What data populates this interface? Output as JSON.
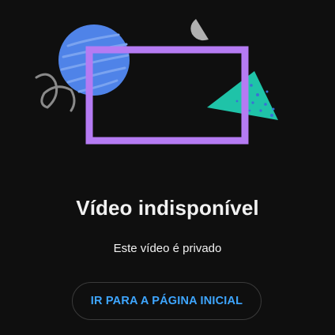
{
  "error": {
    "title": "Vídeo indisponível",
    "message": "Este vídeo é privado",
    "home_button_label": "IR PARA A PÁGINA INICIAL"
  },
  "illustration": {
    "shapes": [
      "blue-circle-shape",
      "purple-frame-shape",
      "teal-triangle-shape",
      "gray-half-circle-shape",
      "gray-squiggle-shape"
    ]
  },
  "colors": {
    "background": "#0f0f0f",
    "title_text": "#f1f1f1",
    "button_text": "#3ea6ff",
    "button_border": "#3a3a3a",
    "circle": "#4f83e8",
    "frame": "#b57bf3",
    "triangle": "#1fc3a8",
    "squiggle": "#8a8a8a",
    "half_circle": "#b0b0b0"
  }
}
